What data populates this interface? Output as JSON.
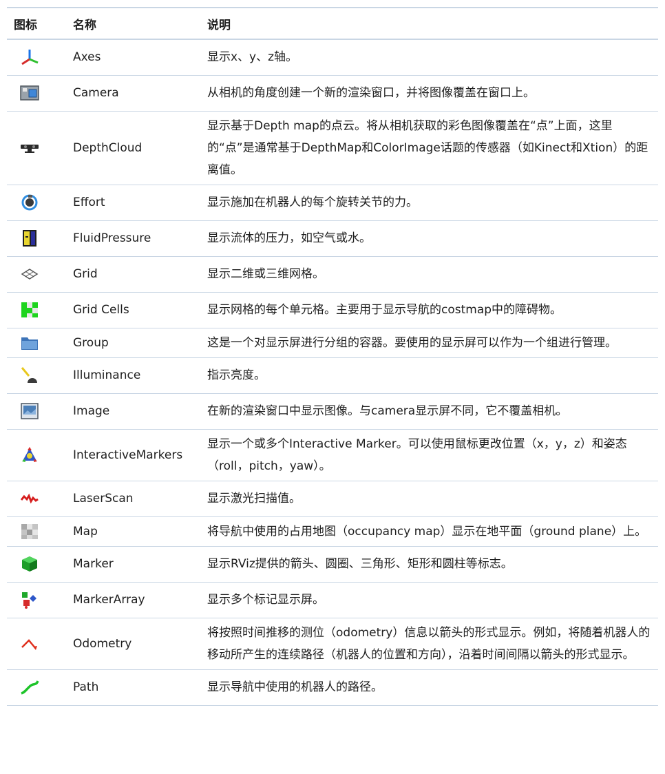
{
  "table": {
    "headers": {
      "icon": "图标",
      "name": "名称",
      "description": "说明"
    },
    "rows": [
      {
        "icon": "axes-icon",
        "name": "Axes",
        "description": "显示x、y、z轴。"
      },
      {
        "icon": "camera-icon",
        "name": "Camera",
        "description": "从相机的角度创建一个新的渲染窗口，并将图像覆盖在窗口上。"
      },
      {
        "icon": "depthcloud-icon",
        "name": "DepthCloud",
        "description": "显示基于Depth map的点云。将从相机获取的彩色图像覆盖在“点”上面，这里的“点”是通常基于DepthMap和ColorImage话题的传感器（如Kinect和Xtion）的距离值。"
      },
      {
        "icon": "effort-icon",
        "name": "Effort",
        "description": "显示施加在机器人的每个旋转关节的力。"
      },
      {
        "icon": "fluidpressure-icon",
        "name": "FluidPressure",
        "description": "显示流体的压力，如空气或水。"
      },
      {
        "icon": "grid-icon",
        "name": "Grid",
        "description": "显示二维或三维网格。"
      },
      {
        "icon": "gridcells-icon",
        "name": "Grid Cells",
        "description": "显示网格的每个单元格。主要用于显示导航的costmap中的障碍物。"
      },
      {
        "icon": "group-folder-icon",
        "name": "Group",
        "description": "这是一个对显示屏进行分组的容器。要使用的显示屏可以作为一个组进行管理。"
      },
      {
        "icon": "illuminance-icon",
        "name": "Illuminance",
        "description": "指示亮度。"
      },
      {
        "icon": "image-icon",
        "name": "Image",
        "description": "在新的渲染窗口中显示图像。与camera显示屏不同，它不覆盖相机。"
      },
      {
        "icon": "interactive-markers-icon",
        "name": "InteractiveMarkers",
        "description": "显示一个或多个Interactive Marker。可以使用鼠标更改位置（x，y，z）和姿态（roll，pitch，yaw）。"
      },
      {
        "icon": "laserscan-icon",
        "name": "LaserScan",
        "description": "显示激光扫描值。"
      },
      {
        "icon": "map-icon",
        "name": "Map",
        "description": "将导航中使用的占用地图（occupancy map）显示在地平面（ground plane）上。"
      },
      {
        "icon": "marker-cube-icon",
        "name": "Marker",
        "description": "显示RViz提供的箭头、圆圈、三角形、矩形和圆柱等标志。"
      },
      {
        "icon": "marker-array-icon",
        "name": "MarkerArray",
        "description": "显示多个标记显示屏。"
      },
      {
        "icon": "odometry-icon",
        "name": "Odometry",
        "description": "将按照时间推移的测位（odometry）信息以箭头的形式显示。例如，将随着机器人的移动所产生的连续路径（机器人的位置和方向），沿着时间间隔以箭头的形式显示。"
      },
      {
        "icon": "path-icon",
        "name": "Path",
        "description": "显示导航中使用的机器人的路径。"
      }
    ]
  }
}
